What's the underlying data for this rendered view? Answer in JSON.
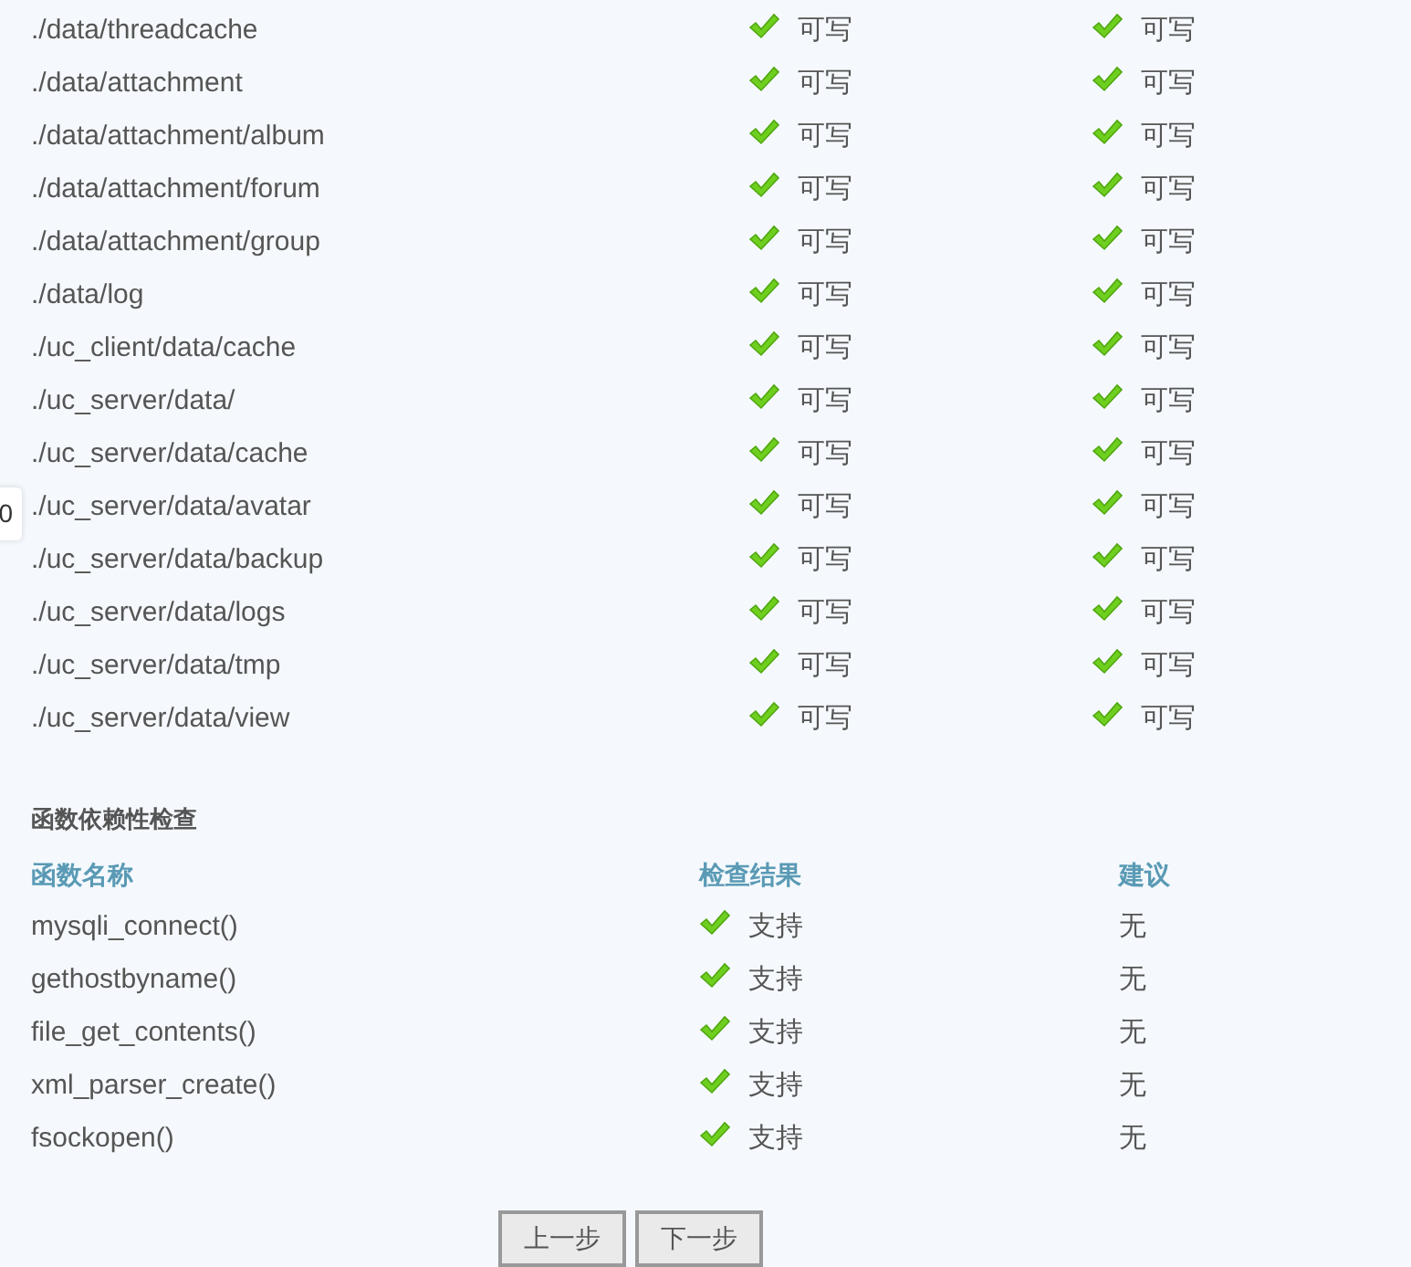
{
  "side_tab": {
    "text": "0"
  },
  "dirs": [
    {
      "path": "./data/threadcache",
      "current": {
        "ok": true,
        "text": "可写"
      },
      "required": {
        "ok": true,
        "text": "可写"
      }
    },
    {
      "path": "./data/attachment",
      "current": {
        "ok": true,
        "text": "可写"
      },
      "required": {
        "ok": true,
        "text": "可写"
      }
    },
    {
      "path": "./data/attachment/album",
      "current": {
        "ok": true,
        "text": "可写"
      },
      "required": {
        "ok": true,
        "text": "可写"
      }
    },
    {
      "path": "./data/attachment/forum",
      "current": {
        "ok": true,
        "text": "可写"
      },
      "required": {
        "ok": true,
        "text": "可写"
      }
    },
    {
      "path": "./data/attachment/group",
      "current": {
        "ok": true,
        "text": "可写"
      },
      "required": {
        "ok": true,
        "text": "可写"
      }
    },
    {
      "path": "./data/log",
      "current": {
        "ok": true,
        "text": "可写"
      },
      "required": {
        "ok": true,
        "text": "可写"
      }
    },
    {
      "path": "./uc_client/data/cache",
      "current": {
        "ok": true,
        "text": "可写"
      },
      "required": {
        "ok": true,
        "text": "可写"
      }
    },
    {
      "path": "./uc_server/data/",
      "current": {
        "ok": true,
        "text": "可写"
      },
      "required": {
        "ok": true,
        "text": "可写"
      }
    },
    {
      "path": "./uc_server/data/cache",
      "current": {
        "ok": true,
        "text": "可写"
      },
      "required": {
        "ok": true,
        "text": "可写"
      }
    },
    {
      "path": "./uc_server/data/avatar",
      "current": {
        "ok": true,
        "text": "可写"
      },
      "required": {
        "ok": true,
        "text": "可写"
      }
    },
    {
      "path": "./uc_server/data/backup",
      "current": {
        "ok": true,
        "text": "可写"
      },
      "required": {
        "ok": true,
        "text": "可写"
      }
    },
    {
      "path": "./uc_server/data/logs",
      "current": {
        "ok": true,
        "text": "可写"
      },
      "required": {
        "ok": true,
        "text": "可写"
      }
    },
    {
      "path": "./uc_server/data/tmp",
      "current": {
        "ok": true,
        "text": "可写"
      },
      "required": {
        "ok": true,
        "text": "可写"
      }
    },
    {
      "path": "./uc_server/data/view",
      "current": {
        "ok": true,
        "text": "可写"
      },
      "required": {
        "ok": true,
        "text": "可写"
      }
    }
  ],
  "functions": {
    "title": "函数依赖性检查",
    "columns": [
      "函数名称",
      "检查结果",
      "建议"
    ],
    "rows": [
      {
        "name": "mysqli_connect()",
        "result": {
          "ok": true,
          "text": "支持"
        },
        "advice": "无"
      },
      {
        "name": "gethostbyname()",
        "result": {
          "ok": true,
          "text": "支持"
        },
        "advice": "无"
      },
      {
        "name": "file_get_contents()",
        "result": {
          "ok": true,
          "text": "支持"
        },
        "advice": "无"
      },
      {
        "name": "xml_parser_create()",
        "result": {
          "ok": true,
          "text": "支持"
        },
        "advice": "无"
      },
      {
        "name": "fsockopen()",
        "result": {
          "ok": true,
          "text": "支持"
        },
        "advice": "无"
      }
    ]
  },
  "buttons": [
    "上一步",
    "下一步"
  ]
}
